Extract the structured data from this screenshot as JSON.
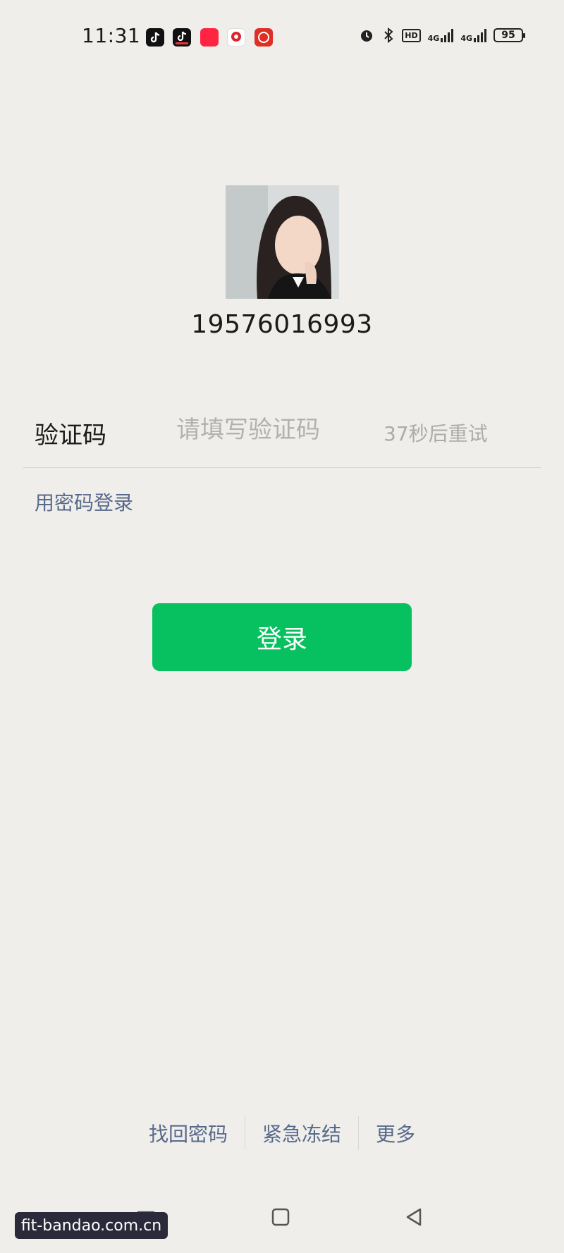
{
  "status_bar": {
    "time": "11:31",
    "hd_label": "HD",
    "network_1": "4G",
    "network_2": "4G",
    "battery": "95",
    "icons": [
      "tiktok-icon",
      "tiktok-lite-icon",
      "xiaohongshu-icon",
      "app-icon",
      "pinduoduo-icon",
      "alarm-icon",
      "bluetooth-icon"
    ]
  },
  "account": {
    "phone_number": "19576016993"
  },
  "verification": {
    "label": "验证码",
    "placeholder": "请填写验证码",
    "retry_text": "37秒后重试"
  },
  "alt_login": {
    "password_login": "用密码登录"
  },
  "login_button": {
    "label": "登录"
  },
  "footer": {
    "recover_password": "找回密码",
    "emergency_freeze": "紧急冻结",
    "more": "更多"
  },
  "watermark": {
    "text": "fit-bandao.com.cn"
  },
  "colors": {
    "background": "#efeeeb",
    "primary_green": "#07c160",
    "link_blue_gray": "#58698a"
  }
}
